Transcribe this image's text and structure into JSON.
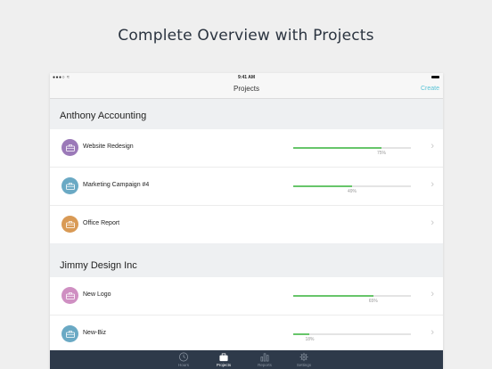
{
  "headline": "Complete Overview with Projects",
  "status": {
    "time": "9:41 AM"
  },
  "nav": {
    "title": "Projects",
    "create": "Create"
  },
  "groups": [
    {
      "title": "Anthony Accounting",
      "projects": [
        {
          "name": "Website Redesign",
          "color": "#9b79b8",
          "progress": 0.75,
          "percent": "75%"
        },
        {
          "name": "Marketing Campaign #4",
          "color": "#6aa9c4",
          "progress": 0.5,
          "percent": "49%"
        },
        {
          "name": "Office Report",
          "color": "#d99a55",
          "progress": null,
          "percent": ""
        }
      ]
    },
    {
      "title": "Jimmy Design Inc",
      "projects": [
        {
          "name": "New Logo",
          "color": "#cf8fc2",
          "progress": 0.68,
          "percent": "65%"
        },
        {
          "name": "New-Biz",
          "color": "#6aa9c4",
          "progress": 0.14,
          "percent": "18%"
        }
      ]
    }
  ],
  "tabs": [
    {
      "label": "Hours",
      "icon": "clock-icon",
      "active": false
    },
    {
      "label": "Projects",
      "icon": "briefcase-icon",
      "active": true
    },
    {
      "label": "Reports",
      "icon": "bar-chart-icon",
      "active": false
    },
    {
      "label": "Settings",
      "icon": "gear-icon",
      "active": false
    }
  ]
}
